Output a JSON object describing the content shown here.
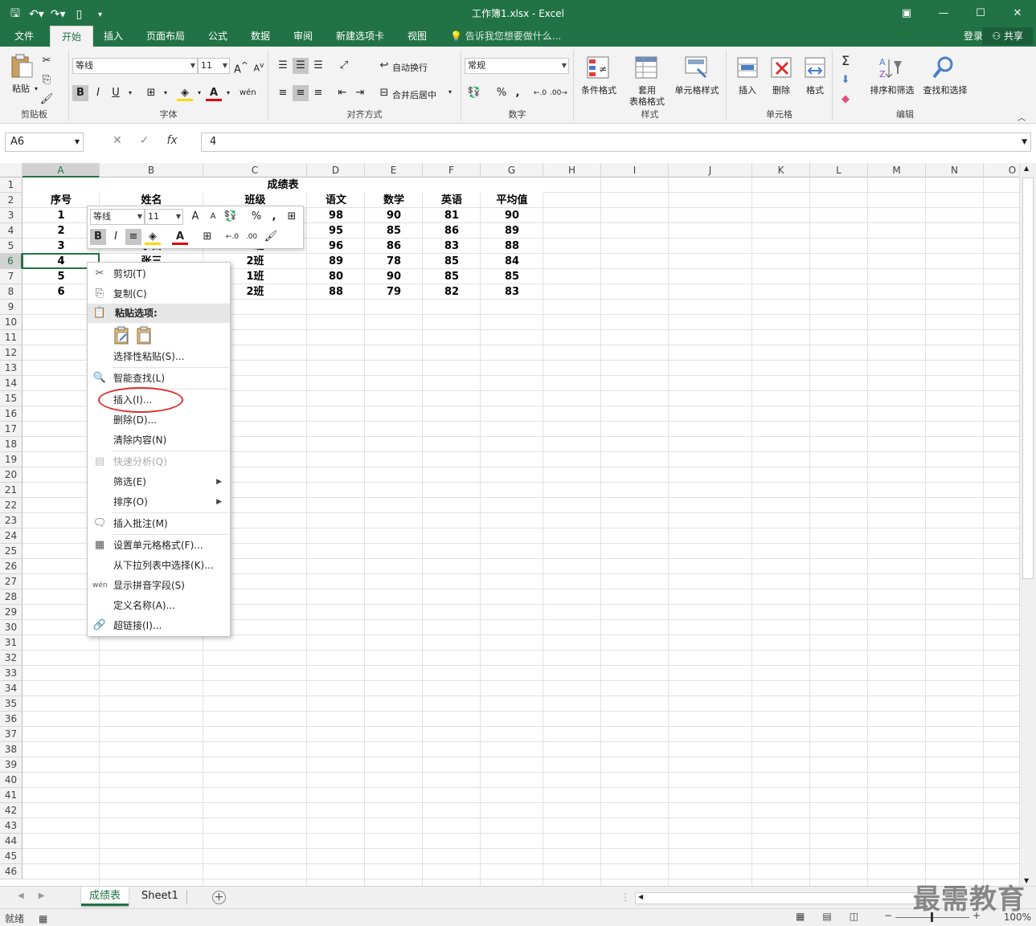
{
  "titlebar": {
    "title": "工作簿1.xlsx - Excel",
    "qat": [
      "save-icon",
      "undo-icon",
      "redo-icon",
      "new-icon",
      "customize-icon"
    ],
    "window_controls": [
      "ribbon-display-icon",
      "minimize-icon",
      "restore-icon",
      "close-icon"
    ]
  },
  "tabs": {
    "file": "文件",
    "home": "开始",
    "insert": "插入",
    "layout": "页面布局",
    "formulas": "公式",
    "data": "数据",
    "review": "审阅",
    "newtab": "新建选项卡",
    "view": "视图",
    "tellme": "告诉我您想要做什么...",
    "login": "登录",
    "share": "共享"
  },
  "ribbon": {
    "clipboard": {
      "label": "剪贴板",
      "paste": "粘贴"
    },
    "font": {
      "label": "字体",
      "name": "等线",
      "size": "11",
      "bold": "B",
      "italic": "I",
      "underline": "U"
    },
    "alignment": {
      "label": "对齐方式",
      "wrap": "自动换行",
      "merge": "合并后居中"
    },
    "number": {
      "label": "数字",
      "format": "常规",
      "percent": "%",
      "comma": ","
    },
    "styles": {
      "label": "样式",
      "cond": "条件格式",
      "table1": "套用",
      "table2": "表格格式",
      "cell": "单元格样式"
    },
    "cells": {
      "label": "单元格",
      "insert": "插入",
      "delete": "删除",
      "format": "格式"
    },
    "editing": {
      "label": "编辑",
      "sort": "排序和筛选",
      "find": "查找和选择"
    }
  },
  "formula": {
    "namebox": "A6",
    "fx": "fx",
    "value": "4"
  },
  "columns": [
    "A",
    "B",
    "C",
    "D",
    "E",
    "F",
    "G",
    "H",
    "I",
    "J",
    "K",
    "L",
    "M",
    "N",
    "O"
  ],
  "rows": [
    "1",
    "2",
    "3",
    "4",
    "5",
    "6",
    "7",
    "8",
    "9",
    "10",
    "11",
    "12",
    "13",
    "14",
    "15",
    "16",
    "17",
    "18",
    "19",
    "20",
    "21",
    "22",
    "23",
    "24",
    "25",
    "26",
    "27",
    "28",
    "29",
    "30",
    "31",
    "32",
    "33",
    "34",
    "35",
    "36",
    "37",
    "38",
    "39",
    "40",
    "41",
    "42",
    "43",
    "44",
    "45",
    "46"
  ],
  "sheet": {
    "title": "成绩表",
    "headers": [
      "序号",
      "姓名",
      "班级",
      "语文",
      "数学",
      "英语",
      "平均值"
    ],
    "data": [
      [
        "1",
        "",
        "",
        "98",
        "90",
        "81",
        "90"
      ],
      [
        "2",
        "",
        "",
        "95",
        "85",
        "86",
        "89"
      ],
      [
        "3",
        "",
        "1班",
        "96",
        "86",
        "83",
        "88"
      ],
      [
        "4",
        "张三",
        "2班",
        "89",
        "78",
        "85",
        "84"
      ],
      [
        "5",
        "",
        "1班",
        "80",
        "90",
        "85",
        "85"
      ],
      [
        "6",
        "",
        "2班",
        "88",
        "79",
        "82",
        "83"
      ]
    ],
    "fragment_b5": "子白"
  },
  "minitoolbar": {
    "font": "等线",
    "size": "11",
    "bold": "B",
    "italic": "I",
    "percent": "%",
    "comma": ","
  },
  "context_menu": {
    "cut": "剪切(T)",
    "copy": "复制(C)",
    "paste_options": "粘贴选项:",
    "paste_special": "选择性粘贴(S)...",
    "smart_lookup": "智能查找(L)",
    "insert": "插入(I)...",
    "delete": "删除(D)...",
    "clear": "清除内容(N)",
    "quick_analysis": "快速分析(Q)",
    "filter": "筛选(E)",
    "sort": "排序(O)",
    "insert_comment": "插入批注(M)",
    "format_cells": "设置单元格格式(F)...",
    "pick_list": "从下拉列表中选择(K)...",
    "phonetic": "显示拼音字段(S)",
    "define_name": "定义名称(A)...",
    "hyperlink": "超链接(I)..."
  },
  "sheets": {
    "active": "成绩表",
    "other": "Sheet1",
    "add": "+"
  },
  "status": {
    "ready": "就绪",
    "zoom": "100%",
    "minus": "−",
    "plus": "+"
  },
  "watermark": "最需教育",
  "colors": {
    "accent": "#217346",
    "highlight": "#e03030"
  }
}
